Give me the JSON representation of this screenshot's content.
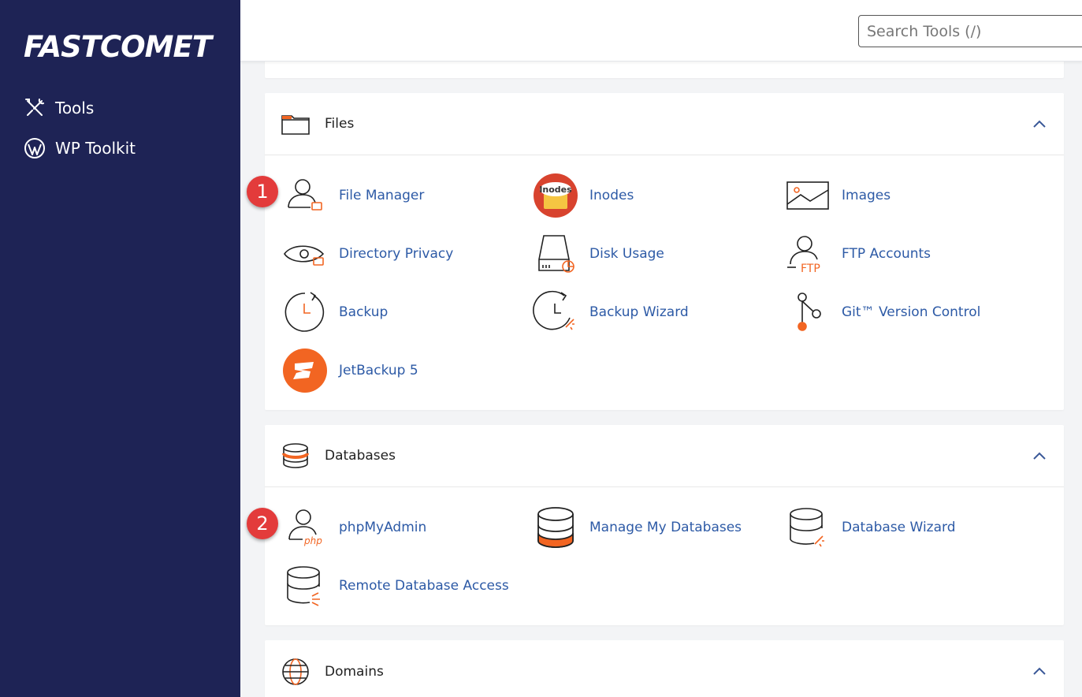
{
  "sidebar": {
    "logo": "FASTCOMET",
    "items": [
      {
        "label": "Tools",
        "icon": "tools-icon"
      },
      {
        "label": "WP Toolkit",
        "icon": "wordpress-icon"
      }
    ]
  },
  "header": {
    "search_placeholder": "Search Tools (/)"
  },
  "sections": {
    "files": {
      "title": "Files",
      "tools": [
        "File Manager",
        "Inodes",
        "Images",
        "Directory Privacy",
        "Disk Usage",
        "FTP Accounts",
        "Backup",
        "Backup Wizard",
        "Git™ Version Control",
        "JetBackup 5"
      ],
      "inodes_icon_text": "Inodes"
    },
    "databases": {
      "title": "Databases",
      "tools": [
        "phpMyAdmin",
        "Manage My Databases",
        "Database Wizard",
        "Remote Database Access"
      ],
      "php_icon_text": "php"
    },
    "domains": {
      "title": "Domains"
    }
  },
  "annotations": {
    "badge1": "1",
    "badge2": "2"
  },
  "colors": {
    "sidebar": "#1e2355",
    "accent": "#f26522",
    "link": "#2d5aa6",
    "badge": "#e33b3b"
  }
}
